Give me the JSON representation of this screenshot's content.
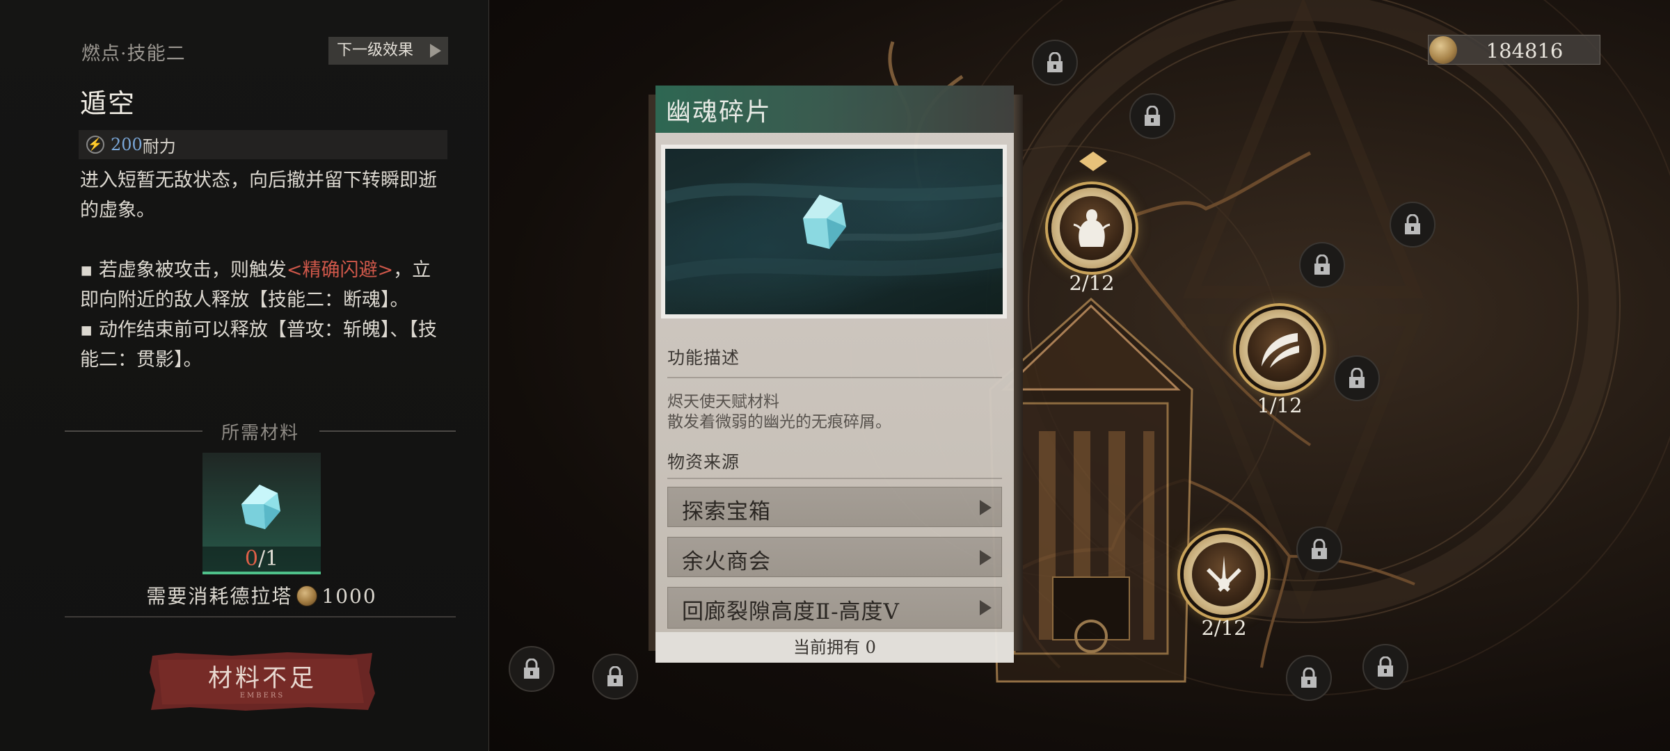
{
  "left_panel": {
    "skill_subtitle": "燃点·技能二",
    "next_level_label": "下一级效果",
    "skill_name": "遁空",
    "cost_value": "200",
    "cost_unit": "耐力",
    "description_line1": "进入短暂无敌状态，向后撤并留下转瞬即逝的虚象。",
    "bullet1_pre": "▪ 若虚象被攻击，则触发",
    "bullet1_highlight": "<精确闪避>",
    "bullet1_post": "，立即向附近的敌人释放【技能二：断魂】。",
    "bullet2": "▪ 动作结束前可以释放【普攻：斩魄】、【技能二：贯影】。",
    "materials_header": "所需材料",
    "material_count_have": "0",
    "material_count_need": "/1",
    "consume_label": "需要消耗德拉塔",
    "consume_amount": "1000",
    "insufficient_label": "材料不足",
    "insufficient_sublabel": "EMBERS"
  },
  "currency": {
    "amount": "184816"
  },
  "nodes": [
    {
      "count": "2/12",
      "icon": "angel-figure-icon"
    },
    {
      "count": "1/12",
      "icon": "slash-arc-icon"
    },
    {
      "count": "2/12",
      "icon": "swords-emblem-icon"
    }
  ],
  "popup": {
    "title": "幽魂碎片",
    "function_label": "功能描述",
    "function_line1": "烬天使天赋材料",
    "function_line2": "散发着微弱的幽光的无痕碎屑。",
    "source_label": "物资来源",
    "sources": [
      "探索宝箱",
      "余火商会",
      "回廊裂隙高度Ⅱ-高度Ⅴ"
    ],
    "owned_label": "当前拥有 0"
  },
  "colors": {
    "accent_gold": "#c9a35a",
    "highlight_red": "#d0584a",
    "cost_blue": "#7aa7d8",
    "title_green": "#2f6a55",
    "insufficient_red": "#7a2a26"
  }
}
